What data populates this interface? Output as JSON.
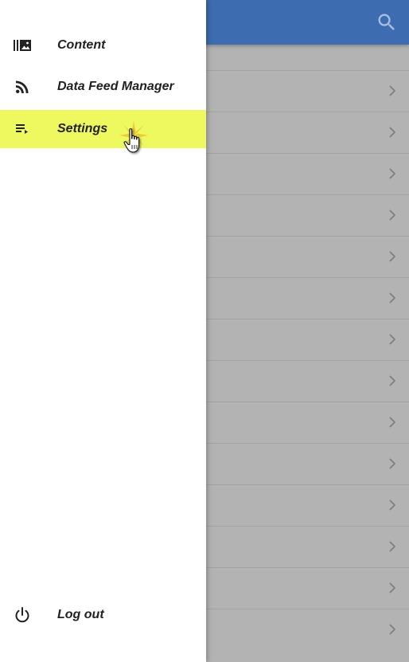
{
  "drawer": {
    "items": [
      {
        "label": "Content",
        "icon": "video-library-icon"
      },
      {
        "label": "Data Feed Manager",
        "icon": "rss-feed-icon"
      },
      {
        "label": "Settings",
        "icon": "playlist-icon",
        "active": true
      }
    ],
    "logout": {
      "label": "Log out",
      "icon": "power-icon"
    }
  },
  "colors": {
    "appbar": "#3d6cb0",
    "active_highlight": "#eef85f",
    "scrim": "#b3b3b3"
  }
}
